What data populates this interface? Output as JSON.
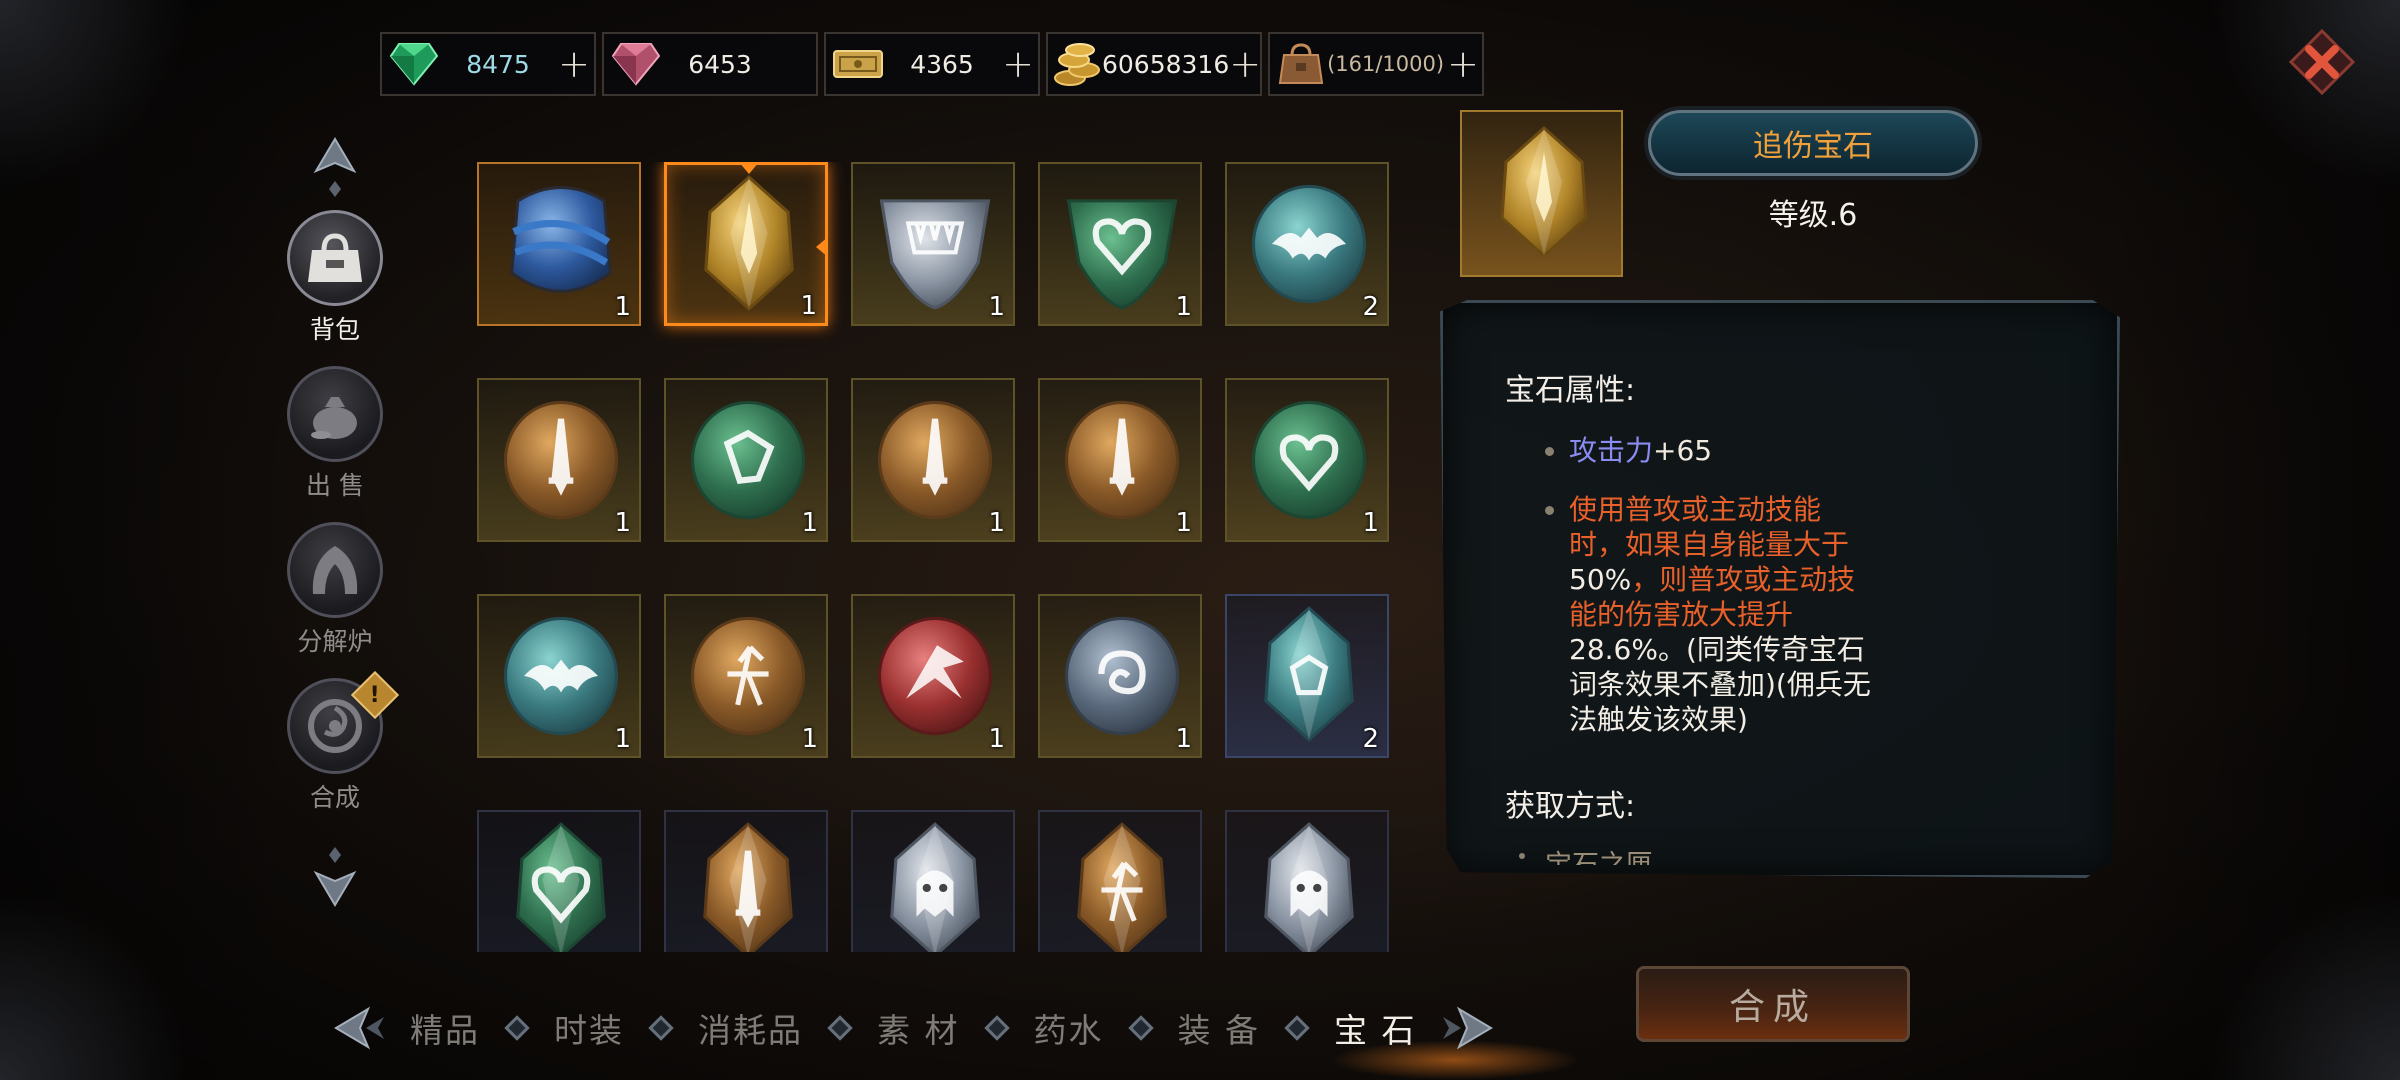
{
  "currencies": [
    {
      "icon": "green-gem-icon",
      "value": "8475",
      "color": "#9fd9e6",
      "has_plus": true
    },
    {
      "icon": "pink-gem-icon",
      "value": "6453",
      "color": "#f0ece4",
      "has_plus": false
    },
    {
      "icon": "ticket-icon",
      "value": "4365",
      "color": "#f0ece4",
      "has_plus": true
    },
    {
      "icon": "gold-coins-icon",
      "value": "60658316",
      "color": "#f0ece4",
      "has_plus": true
    },
    {
      "icon": "bag-capacity-icon",
      "value": "(161/1000)",
      "color": "#c9b9a0",
      "has_plus": true
    }
  ],
  "plus_symbol": "+",
  "side_nav": [
    {
      "label": "背包",
      "icon": "backpack-icon",
      "active": true
    },
    {
      "label": "出 售",
      "icon": "money-bag-icon",
      "active": false
    },
    {
      "label": "分解炉",
      "icon": "furnace-icon",
      "active": false
    },
    {
      "label": "合成",
      "icon": "synthesis-icon",
      "active": false,
      "alert": "!"
    }
  ],
  "grid_items": [
    {
      "gem": "blue-ribbon-ore",
      "count": "1",
      "frame": "orange"
    },
    {
      "gem": "gold-crystal",
      "count": "1",
      "frame": "selected"
    },
    {
      "gem": "silver-fang-shield",
      "count": "1",
      "frame": "gold"
    },
    {
      "gem": "green-heart-shield",
      "count": "1",
      "frame": "gold"
    },
    {
      "gem": "teal-bat-round",
      "count": "2",
      "frame": "gold"
    },
    {
      "gem": "amber-sword-round",
      "count": "1",
      "frame": "gold"
    },
    {
      "gem": "green-rune-round",
      "count": "1",
      "frame": "gold"
    },
    {
      "gem": "amber-sword-round",
      "count": "1",
      "frame": "gold"
    },
    {
      "gem": "amber-sword-round",
      "count": "1",
      "frame": "gold"
    },
    {
      "gem": "green-heart-round",
      "count": "1",
      "frame": "gold"
    },
    {
      "gem": "teal-bat-round",
      "count": "1",
      "frame": "gold"
    },
    {
      "gem": "amber-arrows-round",
      "count": "1",
      "frame": "gold"
    },
    {
      "gem": "red-claw-round",
      "count": "1",
      "frame": "gold"
    },
    {
      "gem": "steel-swirl-round",
      "count": "1",
      "frame": "gold"
    },
    {
      "gem": "teal-crystal",
      "count": "2",
      "frame": "blue"
    },
    {
      "gem": "green-heart-crystal",
      "count": "",
      "frame": "dim"
    },
    {
      "gem": "amber-sword-crystal",
      "count": "",
      "frame": "dim"
    },
    {
      "gem": "silver-ghost-crystal",
      "count": "",
      "frame": "dim"
    },
    {
      "gem": "amber-arrows-crystal",
      "count": "",
      "frame": "dim"
    },
    {
      "gem": "silver-skull-crystal",
      "count": "",
      "frame": "dim"
    }
  ],
  "detail": {
    "gem_icon": "gold-crystal",
    "name": "追伤宝石",
    "level": "等级.6",
    "attr_title": "宝石属性:",
    "stat_key": "攻击力",
    "stat_value": "+65",
    "effect_part1": "使用普攻或主动技能时，如果自身能量大于",
    "effect_val1": "50%",
    "effect_part2": "，则普攻或主动技能的伤害放大提升",
    "effect_val2": "28.6%",
    "effect_note": "。(同类传奇宝石词条效果不叠加)(佣兵无法触发该效果)",
    "source_title": "获取方式:",
    "source_item": "宝石之匣"
  },
  "compose_button": "合成",
  "tabs": [
    {
      "label": "精品",
      "active": false
    },
    {
      "label": "时装",
      "active": false
    },
    {
      "label": "消耗品",
      "active": false
    },
    {
      "label": "素 材",
      "active": false
    },
    {
      "label": "药水",
      "active": false
    },
    {
      "label": "装 备",
      "active": false
    },
    {
      "label": "宝 石",
      "active": true
    }
  ],
  "colors": {
    "accent_orange": "#ff8a1c",
    "name_text": "#f2a13a",
    "stat_blue": "#8b8cf2",
    "effect_orange": "#e8602a"
  }
}
